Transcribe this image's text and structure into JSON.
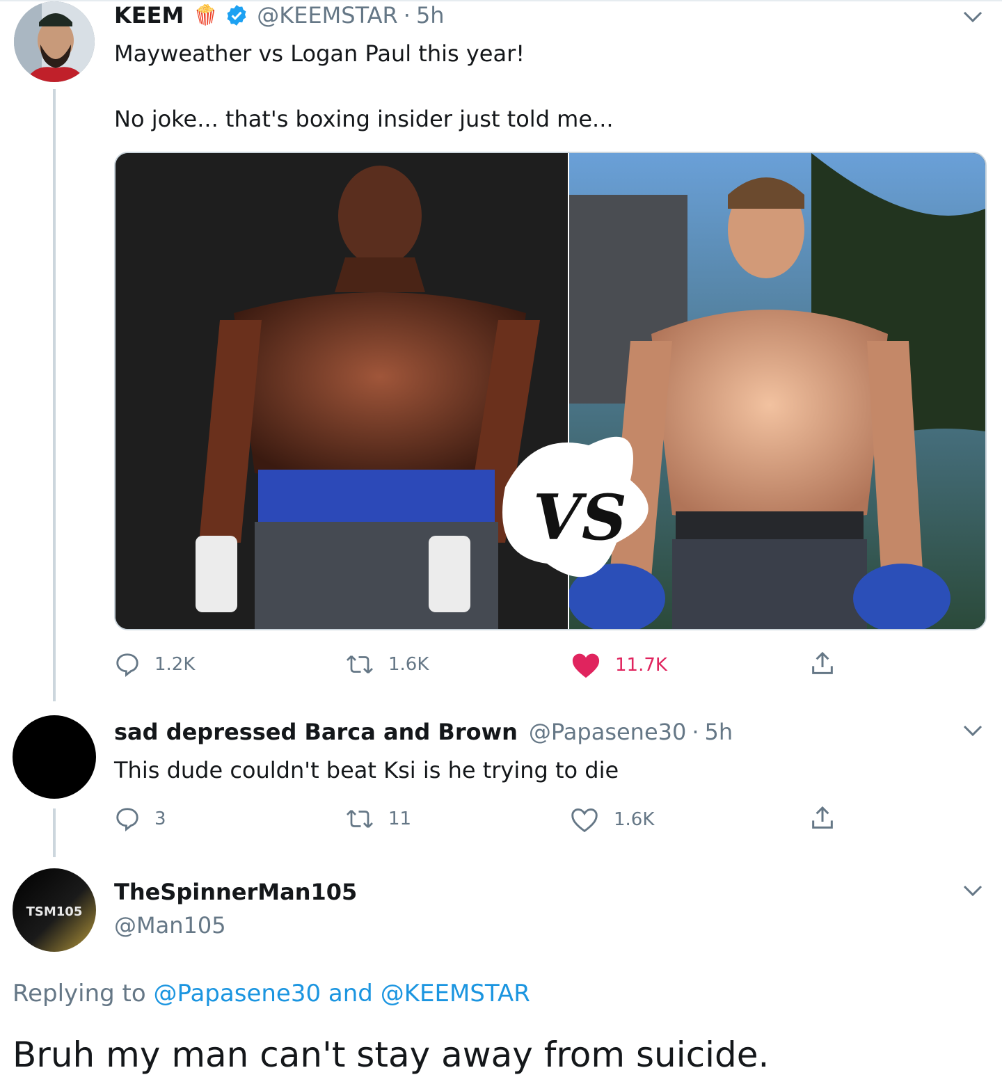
{
  "tweet1": {
    "name": "KEEM",
    "emoji": "🍿",
    "verified_icon": "verified-badge-icon",
    "handle": "@KEEMSTAR",
    "separator": "·",
    "time": "5h",
    "text_line1": "Mayweather vs Logan Paul this year!",
    "text_line2": "No joke... that's boxing insider just told me...",
    "media": {
      "left_subject": "boxer-left",
      "right_subject": "boxer-right",
      "vs_text": "VS"
    },
    "actions": {
      "replies": "1.2K",
      "retweets": "1.6K",
      "likes": "11.7K",
      "liked": true
    },
    "colors": {
      "like_active": "#e0245e",
      "muted": "#657786"
    }
  },
  "tweet2": {
    "name": "sad depressed Barca and Brown",
    "handle": "@Papasene30",
    "separator": "·",
    "time": "5h",
    "text": "This dude couldn't beat Ksi is he trying to die",
    "actions": {
      "replies": "3",
      "retweets": "11",
      "likes": "1.6K",
      "liked": false
    }
  },
  "tweet3": {
    "name": "TheSpinnerMan105",
    "handle": "@Man105",
    "avatar_text": "TSM105",
    "replying_prefix": "Replying to",
    "replying_user1": "@Papasene30",
    "replying_and": "and",
    "replying_user2": "@KEEMSTAR",
    "text": "Bruh my man can't stay away from suicide."
  }
}
